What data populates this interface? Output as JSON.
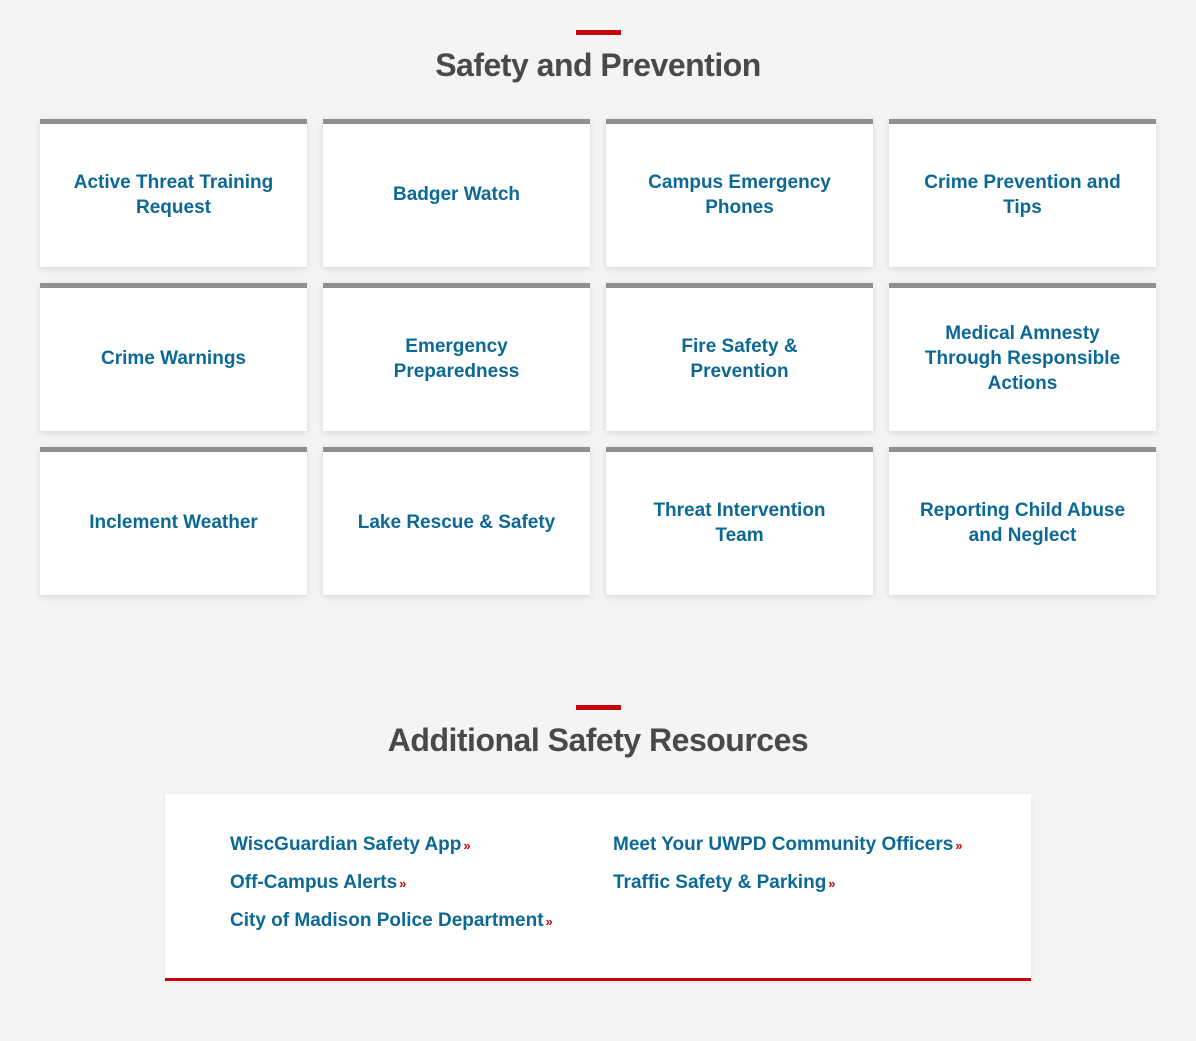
{
  "section1": {
    "title": "Safety and Prevention",
    "cards": [
      "Active Threat Training Request",
      "Badger Watch",
      "Campus Emergency Phones",
      "Crime Prevention and Tips",
      "Crime Warnings",
      "Emergency Preparedness",
      "Fire Safety & Prevention",
      "Medical Amnesty Through Responsible Actions",
      "Inclement Weather",
      "Lake Rescue & Safety",
      "Threat Intervention Team",
      "Reporting Child Abuse and Neglect"
    ]
  },
  "section2": {
    "title": "Additional Safety Resources",
    "links_left": [
      "WiscGuardian Safety App",
      "Off-Campus Alerts",
      "City of Madison Police Department"
    ],
    "links_right": [
      "Meet Your UWPD Community Officers",
      "Traffic Safety & Parking"
    ]
  },
  "colors": {
    "accent_red": "#c5050c",
    "link_blue": "#0c6996",
    "card_top": "#8e8f91",
    "heading": "#494949"
  }
}
